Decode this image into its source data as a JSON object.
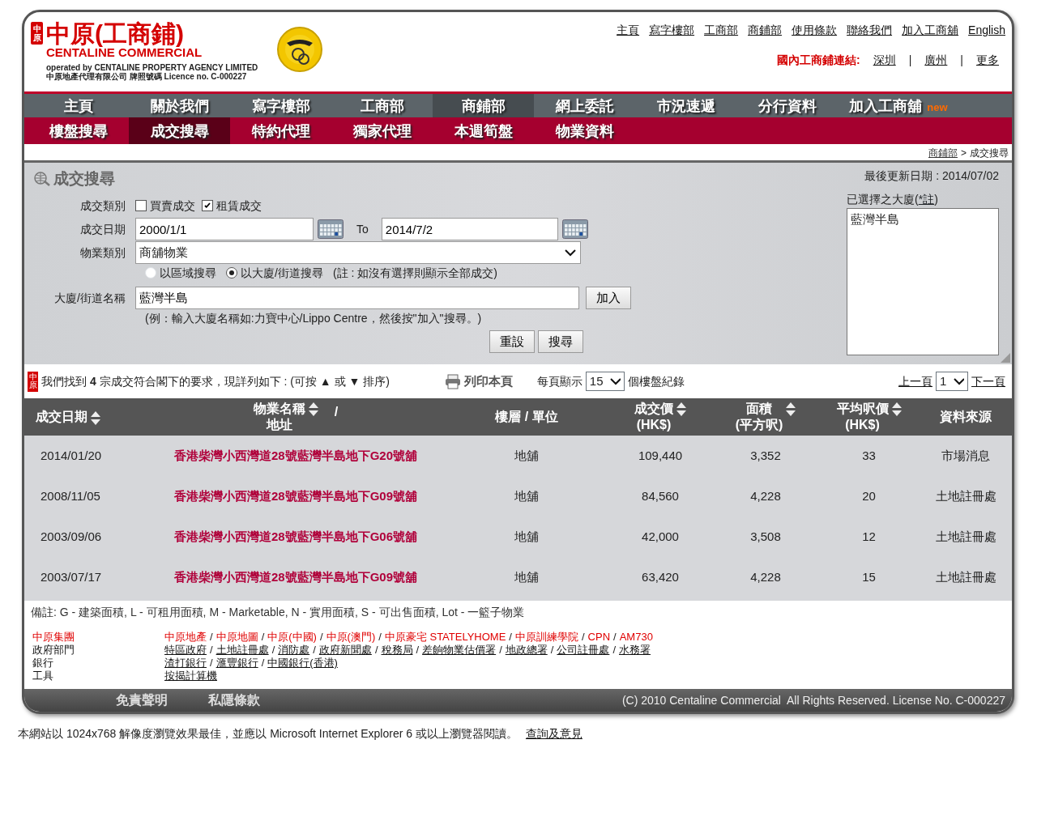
{
  "logo": {
    "mark": "中原",
    "title": "中原(工商鋪)",
    "subtitle": "CENTALINE COMMERCIAL",
    "operated_by": "operated by CENTALINE PROPERTY AGENCY LIMITED",
    "licence": "中原地產代理有限公司 牌照號碼 Licence no. C-000227"
  },
  "top_links": [
    "主頁",
    "寫字樓部",
    "工商部",
    "商鋪部",
    "使用條款",
    "聯絡我們",
    "加入工商舖",
    "English"
  ],
  "mainland_links": {
    "label": "國內工商鋪連結:",
    "separator": "|",
    "links": [
      "深圳",
      "廣州",
      "更多"
    ]
  },
  "main_nav": [
    {
      "label": "主頁",
      "selected": false
    },
    {
      "label": "關於我們",
      "selected": false
    },
    {
      "label": "寫字樓部",
      "selected": false
    },
    {
      "label": "工商部",
      "selected": false
    },
    {
      "label": "商鋪部",
      "selected": true
    },
    {
      "label": "網上委託",
      "selected": false
    },
    {
      "label": "市況速遞",
      "selected": false
    },
    {
      "label": "分行資料",
      "selected": false
    },
    {
      "label": "加入工商舖",
      "selected": false,
      "badge": "new"
    }
  ],
  "sub_nav": [
    {
      "label": "樓盤搜尋",
      "selected": false
    },
    {
      "label": "成交搜尋",
      "selected": true
    },
    {
      "label": "特約代理",
      "selected": false
    },
    {
      "label": "獨家代理",
      "selected": false
    },
    {
      "label": "本週筍盤",
      "selected": false
    },
    {
      "label": "物業資料",
      "selected": false
    }
  ],
  "breadcrumb": {
    "link": "商鋪部",
    "separator": ">",
    "current": "成交搜尋"
  },
  "search": {
    "title": "成交搜尋",
    "last_updated": "最後更新日期 : 2014/07/02",
    "type_label": "成交類別",
    "types": [
      {
        "label": "買賣成交",
        "checked": false
      },
      {
        "label": "租賃成交",
        "checked": true
      }
    ],
    "date_label": "成交日期",
    "date_from": "2000/1/1",
    "date_to_label": "To",
    "date_to": "2014/7/2",
    "property_label": "物業類別",
    "property_value": "商舖物業",
    "modes": [
      {
        "label": "以區域搜尋",
        "selected": false
      },
      {
        "label": "以大廈/街道搜尋",
        "selected": true
      }
    ],
    "mode_note": "(註 : 如沒有選擇則顯示全部成交)",
    "building_label": "大廈/街道名稱",
    "building_value": "藍灣半島",
    "add_button": "加入",
    "example": "(例：輸入大廈名稱如:力寶中心/Lippo Centre，然後按\"加入\"搜尋。)",
    "reset_button": "重設",
    "search_button": "搜尋",
    "selected_label": "已選擇之大廈(",
    "selected_note_link": "*註",
    "selected_label_end": ")",
    "selected_buildings": [
      "藍灣半島"
    ]
  },
  "results": {
    "seal": "中原",
    "summary": "我們找到 **4** 宗成交符合閣下的要求，現詳列如下 : (可按 ▲ 或 ▼ 排序)",
    "print": "列印本頁",
    "per_page_label": "每頁顯示",
    "per_page": "15",
    "per_page_suffix": "個樓盤紀錄",
    "prev": "上一頁",
    "page": "1",
    "next": "下一頁"
  },
  "table": {
    "columns": [
      {
        "label": "成交日期",
        "sortable": true
      },
      {
        "label": "物業名稱",
        "label2": "地址",
        "slash": "/",
        "sortable": true
      },
      {
        "label": "樓層 / 單位",
        "sortable": false
      },
      {
        "label": "成交價",
        "label2": "(HK$)",
        "sortable": true
      },
      {
        "label": "面積",
        "label2": "(平方呎)",
        "sortable": true
      },
      {
        "label": "平均呎價",
        "label2": "(HK$)",
        "sortable": true
      },
      {
        "label": "資料來源",
        "sortable": false
      }
    ],
    "rows": [
      [
        "2014/01/20",
        "香港柴灣小西灣道28號藍灣半島地下G20號舖",
        "地舖",
        "109,440",
        "3,352",
        "33",
        "市場消息"
      ],
      [
        "2008/11/05",
        "香港柴灣小西灣道28號藍灣半島地下G09號舖",
        "地舖",
        "84,560",
        "4,228",
        "20",
        "土地註冊處"
      ],
      [
        "2003/09/06",
        "香港柴灣小西灣道28號藍灣半島地下G06號舖",
        "地舖",
        "42,000",
        "3,508",
        "12",
        "土地註冊處"
      ],
      [
        "2003/07/17",
        "香港柴灣小西灣道28號藍灣半島地下G09號舖",
        "地舖",
        "63,420",
        "4,228",
        "15",
        "土地註冊處"
      ]
    ]
  },
  "note": "備註: G - 建築面積, L - 可租用面積, M - Marketable, N - 實用面積, S - 可出售面積, Lot - 一籃子物業",
  "footer_links": {
    "separator": "/",
    "groups": [
      {
        "label": "中原集團",
        "highlighted": true,
        "lines": [
          [
            "中原地產",
            "中原地圖",
            "中原(中國)",
            "中原(澳門)",
            "中原豪宅 STATELYHOME",
            "中原訓練學院",
            "CPN",
            "AM730"
          ]
        ]
      },
      {
        "label": "政府部門",
        "highlighted": false,
        "lines": [
          [
            "特區政府",
            "土地註冊處",
            "消防處",
            "政府新聞處",
            "稅務局",
            "差餉物業估價署",
            "地政總署",
            "公司註冊處",
            "水務署"
          ]
        ]
      },
      {
        "label": "銀行",
        "highlighted": false,
        "lines": [
          [
            "渣打銀行",
            "滙豐銀行",
            "中國銀行(香港)"
          ]
        ]
      },
      {
        "label": "工具",
        "highlighted": false,
        "lines": [
          [
            "按揭計算機"
          ]
        ]
      }
    ]
  },
  "footer_bar": {
    "links": [
      "免責聲明",
      "私隱條款"
    ],
    "copyright": "(C) 2010 Centaline Commercial  All Rights Reserved. License No. C-000227"
  },
  "bottom": {
    "text": "本網站以 1024x768 解像度瀏覽效果最佳，並應以 Microsoft Internet Explorer 6 或以上瀏覽器閱讀。",
    "link": "查詢及意見"
  }
}
